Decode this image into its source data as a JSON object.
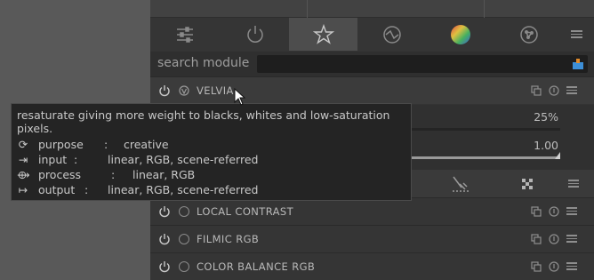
{
  "search": {
    "label": "search module",
    "placeholder": ""
  },
  "active_module": {
    "name": "VELVIA",
    "tooltip": {
      "description": "resaturate giving more weight to blacks, whites and low-saturation pixels.",
      "rows": [
        {
          "icon": "⟳",
          "key": "purpose",
          "value": "creative"
        },
        {
          "icon": "⇥",
          "key": "input",
          "value": "linear, RGB, scene-referred"
        },
        {
          "icon": "⟴",
          "key": "process",
          "value": "linear, RGB"
        },
        {
          "icon": "↦",
          "key": "output",
          "value": "linear, RGB, scene-referred"
        }
      ]
    },
    "sliders": [
      {
        "value_text": "25%",
        "level": 0.25
      },
      {
        "value_text": "1.00",
        "level": 1.0
      }
    ]
  },
  "modules": [
    {
      "name": "LOCAL CONTRAST"
    },
    {
      "name": "FILMIC RGB"
    },
    {
      "name": "COLOR BALANCE RGB"
    }
  ],
  "colors": {
    "panel": "#333333",
    "tab_active": "#4d4d4d",
    "text": "#b8b8b8"
  }
}
